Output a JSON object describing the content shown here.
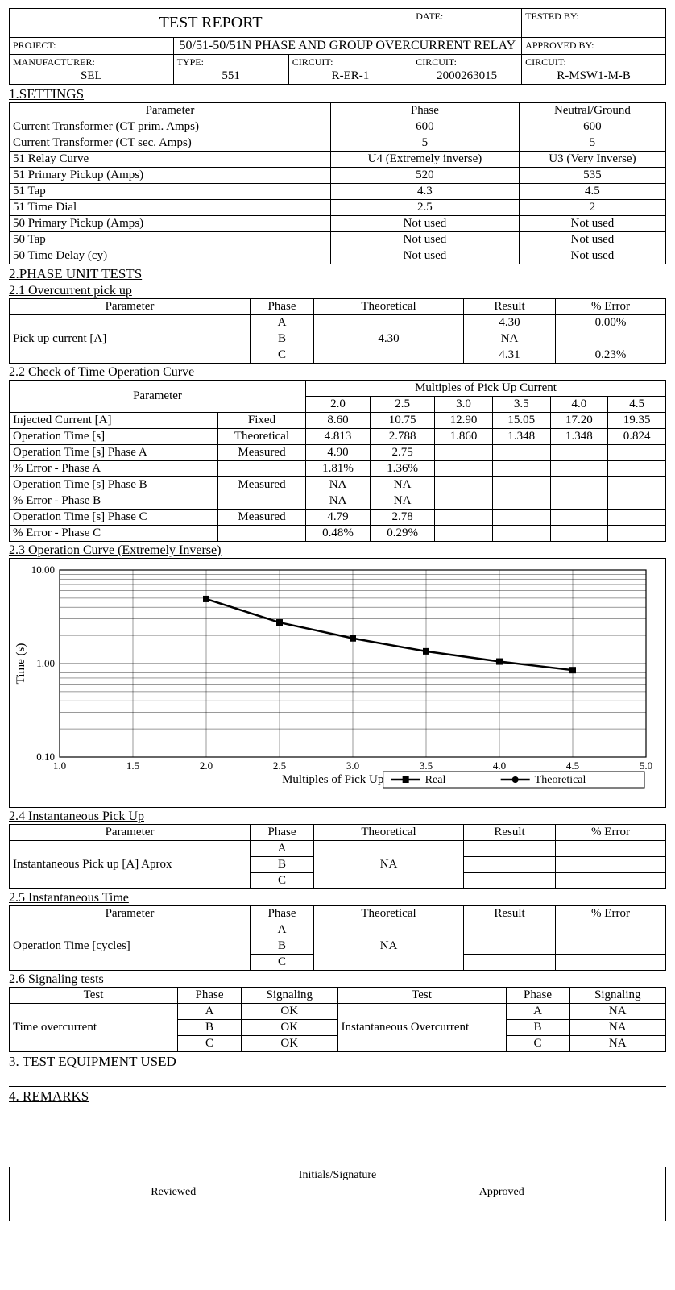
{
  "header": {
    "title": "TEST REPORT",
    "date_label": "DATE:",
    "date": "",
    "tested_label": "TESTED BY:",
    "tested": "",
    "project_label": "PROJECT:",
    "project": "50/51-50/51N PHASE AND GROUP OVERCURRENT RELAY",
    "approved_label": "APPROVED BY:",
    "approved": "",
    "mfr_label": "MANUFACTURER:",
    "mfr": "SEL",
    "type_label": "TYPE:",
    "type": "551",
    "circuit1_label": "CIRCUIT:",
    "circuit1": "R-ER-1",
    "circuit2_label": "CIRCUIT:",
    "circuit2": "2000263015",
    "circuit3_label": "CIRCUIT:",
    "circuit3": "R-MSW1-M-B"
  },
  "sec1": {
    "title": "1.SETTINGS",
    "cols": [
      "Parameter",
      "Phase",
      "Neutral/Ground"
    ],
    "rows": [
      [
        "Current Transformer (CT prim. Amps)",
        "600",
        "600"
      ],
      [
        "Current Transformer (CT sec. Amps)",
        "5",
        "5"
      ],
      [
        "51 Relay Curve",
        "U4 (Extremely inverse)",
        "U3 (Very Inverse)"
      ],
      [
        "51 Primary Pickup (Amps)",
        "520",
        "535"
      ],
      [
        "51 Tap",
        "4.3",
        "4.5"
      ],
      [
        "51 Time Dial",
        "2.5",
        "2"
      ],
      [
        "50 Primary Pickup (Amps)",
        "Not used",
        "Not used"
      ],
      [
        "50 Tap",
        "Not used",
        "Not used"
      ],
      [
        "50 Time Delay (cy)",
        "Not used",
        "Not used"
      ]
    ]
  },
  "sec2": {
    "title": "2.PHASE UNIT TESTS"
  },
  "sec2_1": {
    "title": "2.1 Overcurrent pick up",
    "cols": [
      "Parameter",
      "Phase",
      "Theoretical",
      "Result",
      "% Error"
    ],
    "param": "Pick up current [A]",
    "theo": "4.30",
    "rows": [
      [
        "A",
        "4.30",
        "0.00%"
      ],
      [
        "B",
        "NA",
        ""
      ],
      [
        "C",
        "4.31",
        "0.23%"
      ]
    ]
  },
  "sec2_2": {
    "title": "2.2 Check of Time Operation Curve",
    "super": "Multiples of Pick Up Current",
    "mults": [
      "2.0",
      "2.5",
      "3.0",
      "3.5",
      "4.0",
      "4.5"
    ],
    "param": "Parameter",
    "rows": [
      {
        "label": "Injected Current [A]",
        "note": "Fixed",
        "v": [
          "8.60",
          "10.75",
          "12.90",
          "15.05",
          "17.20",
          "19.35"
        ]
      },
      {
        "label": "Operation Time [s]",
        "note": "Theoretical",
        "v": [
          "4.813",
          "2.788",
          "1.860",
          "1.348",
          "1.348",
          "0.824"
        ]
      },
      {
        "label": "Operation Time [s]  Phase A",
        "note": "Measured",
        "v": [
          "4.90",
          "2.75",
          "",
          "",
          "",
          ""
        ]
      },
      {
        "label": "% Error - Phase A",
        "note": "",
        "v": [
          "1.81%",
          "1.36%",
          "",
          "",
          "",
          ""
        ]
      },
      {
        "label": "Operation Time [s]  Phase B",
        "note": "Measured",
        "v": [
          "NA",
          "NA",
          "",
          "",
          "",
          ""
        ]
      },
      {
        "label": "% Error - Phase B",
        "note": "",
        "v": [
          "NA",
          "NA",
          "",
          "",
          "",
          ""
        ]
      },
      {
        "label": "Operation Time [s]  Phase C",
        "note": "Measured",
        "v": [
          "4.79",
          "2.78",
          "",
          "",
          "",
          ""
        ]
      },
      {
        "label": "% Error - Phase C",
        "note": "",
        "v": [
          "0.48%",
          "0.29%",
          "",
          "",
          "",
          ""
        ]
      }
    ]
  },
  "sec2_3": {
    "title": "2.3  Operation Curve (Extremely Inverse)",
    "ylabel": "Time (s)",
    "xlabel": "Multiples of Pick Up Current",
    "legend": [
      "Real",
      "Theoretical"
    ]
  },
  "sec2_4": {
    "title": "2.4  Instantaneous Pick Up",
    "cols": [
      "Parameter",
      "Phase",
      "Theoretical",
      "Result",
      "% Error"
    ],
    "param": "Instantaneous Pick up  [A]  Aprox",
    "theo": "NA",
    "phases": [
      "A",
      "B",
      "C"
    ]
  },
  "sec2_5": {
    "title": "2.5  Instantaneous  Time",
    "cols": [
      "Parameter",
      "Phase",
      "Theoretical",
      "Result",
      "% Error"
    ],
    "param": "Operation Time [cycles]",
    "theo": "NA",
    "phases": [
      "A",
      "B",
      "C"
    ]
  },
  "sec2_6": {
    "title": "2.6  Signaling tests",
    "cols": [
      "Test",
      "Phase",
      "Signaling",
      "Test",
      "Phase",
      "Signaling"
    ],
    "left": {
      "name": "Time overcurrent",
      "rows": [
        [
          "A",
          "OK"
        ],
        [
          "B",
          "OK"
        ],
        [
          "C",
          "OK"
        ]
      ]
    },
    "right": {
      "name": "Instantaneous Overcurrent",
      "rows": [
        [
          "A",
          "NA"
        ],
        [
          "B",
          "NA"
        ],
        [
          "C",
          "NA"
        ]
      ]
    }
  },
  "sec3": {
    "title": "3.  TEST EQUIPMENT USED"
  },
  "sec4": {
    "title": "4.  REMARKS"
  },
  "sig": {
    "h": "Initials/Signature",
    "r": "Reviewed",
    "a": "Approved"
  },
  "chart_data": {
    "type": "line",
    "x": [
      2.0,
      2.5,
      3.0,
      3.5,
      4.0,
      4.5
    ],
    "series": [
      {
        "name": "Real",
        "values": [
          4.9,
          2.75,
          1.86,
          1.35,
          1.05,
          0.85
        ]
      },
      {
        "name": "Theoretical",
        "values": [
          4.813,
          2.788,
          1.86,
          1.348,
          1.05,
          0.824
        ]
      }
    ],
    "title": "Operation Curve (Extremely Inverse)",
    "xlabel": "Multiples of Pick Up Current",
    "ylabel": "Time (s)",
    "xlim": [
      1.0,
      5.0
    ],
    "ylim": [
      0.1,
      10.0
    ],
    "y_scale": "log",
    "xticks": [
      1.0,
      1.5,
      2.0,
      2.5,
      3.0,
      3.5,
      4.0,
      4.5,
      5.0
    ],
    "yticks": [
      0.1,
      1.0,
      10.0
    ]
  }
}
